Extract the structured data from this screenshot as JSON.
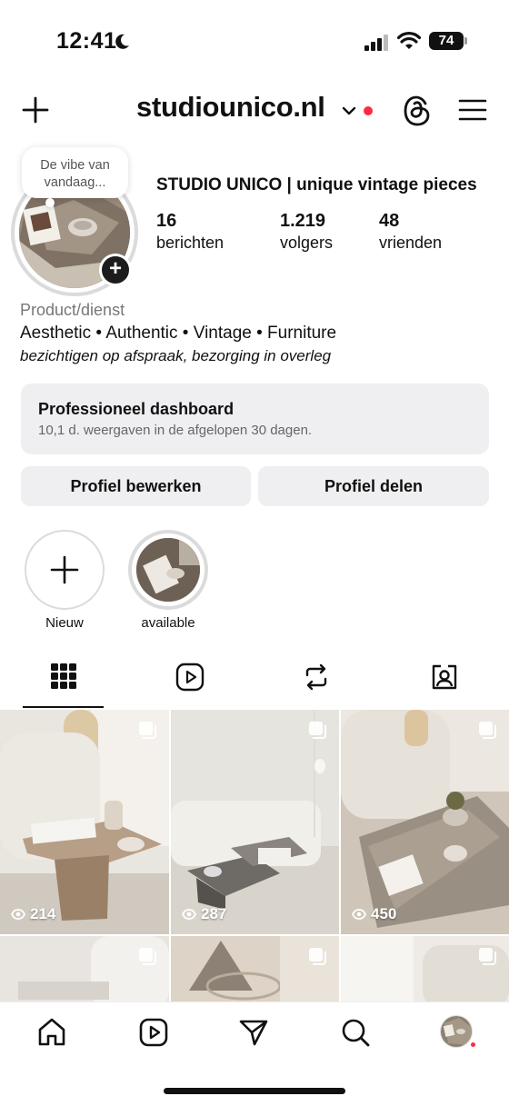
{
  "status_bar": {
    "time": "12:41",
    "battery": "74"
  },
  "header": {
    "username": "studiounico.nl"
  },
  "profile": {
    "note": "De vibe van vandaag...",
    "full_name": "STUDIO UNICO | unique vintage pieces",
    "stats": [
      {
        "value": "16",
        "label": "berichten"
      },
      {
        "value": "1.219",
        "label": "volgers"
      },
      {
        "value": "48",
        "label": "vrienden"
      }
    ],
    "category": "Product/dienst",
    "bio_line1": "Aesthetic • Authentic • Vintage • Furniture",
    "bio_line2": "bezichtigen op afspraak, bezorging in overleg"
  },
  "dashboard": {
    "title": "Professioneel dashboard",
    "subtitle": "10,1 d. weergaven in de afgelopen 30 dagen."
  },
  "buttons": {
    "edit": "Profiel bewerken",
    "share": "Profiel delen"
  },
  "highlights": [
    {
      "label": "Nieuw"
    },
    {
      "label": "available"
    }
  ],
  "tabs": [
    "grid-icon",
    "reels-icon",
    "reposts-icon",
    "tagged-icon"
  ],
  "grid": [
    {
      "views": "214"
    },
    {
      "views": "287"
    },
    {
      "views": "450"
    },
    {
      "views": ""
    },
    {
      "views": ""
    },
    {
      "views": ""
    }
  ],
  "bottom_nav": [
    "home-icon",
    "reels-icon",
    "direct-icon",
    "search-icon",
    "profile-avatar"
  ],
  "colors": {
    "notification_red": "#ff2b3f",
    "button_grey": "#efeff1"
  }
}
